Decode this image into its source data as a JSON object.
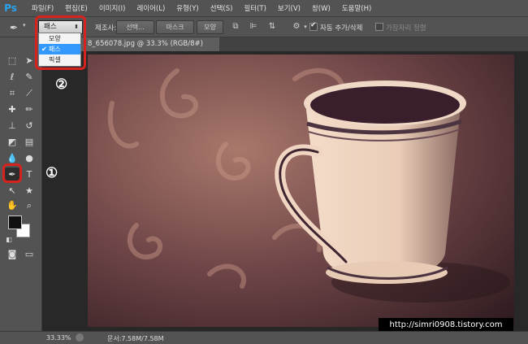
{
  "app": {
    "logo": "Ps"
  },
  "menu": [
    "파일(F)",
    "편집(E)",
    "이미지(I)",
    "레이어(L)",
    "유형(Y)",
    "선택(S)",
    "필터(T)",
    "보기(V)",
    "창(W)",
    "도움말(H)"
  ],
  "options": {
    "mode_value": "패스",
    "make_label": "작성",
    "make_label_visible": "제조사:",
    "btn_selection": "선택...",
    "btn_mask": "마스크",
    "btn_shape": "모양",
    "auto_add_delete_label": "자동 추가/삭제",
    "auto_add_delete_checked": true,
    "align_edges_label": "가장자리 정렬",
    "align_edges_checked": false
  },
  "dropdown": {
    "items": [
      {
        "label": "모양",
        "selected": false
      },
      {
        "label": "패스",
        "selected": true
      },
      {
        "label": "픽셀",
        "selected": false
      }
    ]
  },
  "document": {
    "tab_title": "8_656078.jpg @ 33.3% (RGB/8#)"
  },
  "annotations": {
    "one": "①",
    "two": "②"
  },
  "status": {
    "zoom": "33.33%",
    "doc_size": "문서:7.58M/7.58M"
  },
  "watermark": "http://simri0908.tistory.com",
  "colors": {
    "accent": "#d6231f",
    "selection": "#3399ff",
    "ps_blue": "#29a3f0"
  },
  "icons": [
    "pen-icon",
    "move-icon",
    "marquee-icon",
    "lasso-icon",
    "crop-icon",
    "eyedropper-icon",
    "brush-icon",
    "stamp-icon",
    "eraser-icon",
    "gradient-icon",
    "type-icon",
    "hand-icon",
    "zoom-icon",
    "gear-icon"
  ]
}
